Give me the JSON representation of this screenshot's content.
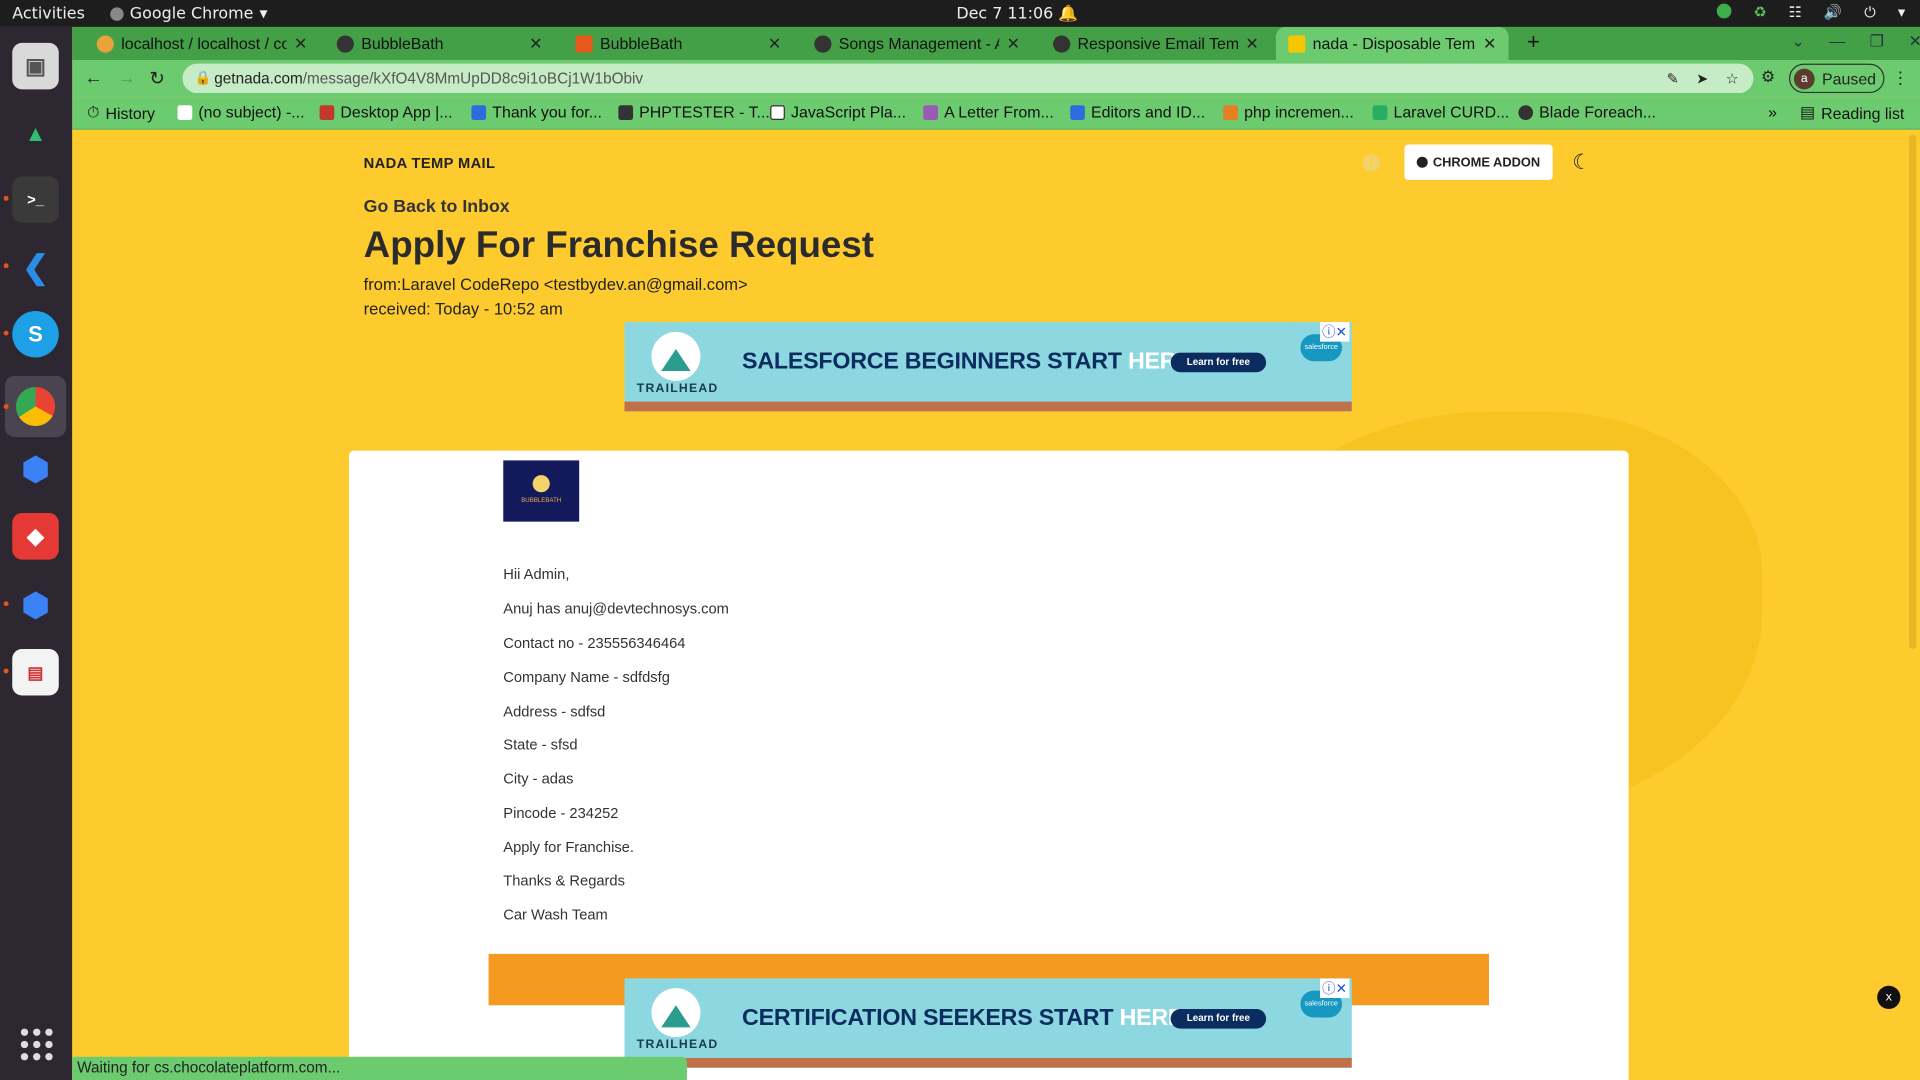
{
  "topbar": {
    "activities": "Activities",
    "app_name": "Google Chrome",
    "clock": "Dec 7  11:06"
  },
  "tabs": [
    {
      "title": "localhost / localhost / cor",
      "favicon_color": "#e8a33c"
    },
    {
      "title": "BubbleBath",
      "favicon_color": "#333"
    },
    {
      "title": "BubbleBath",
      "favicon_color": "#e65a1d"
    },
    {
      "title": "Songs Management - Adm",
      "favicon_color": "#333"
    },
    {
      "title": "Responsive Email Templat",
      "favicon_color": "#333"
    },
    {
      "title": "nada - Disposable Temp E",
      "favicon_color": "#f7c600"
    }
  ],
  "toolbar": {
    "url_host": "getnada.com",
    "url_path": "/message/kXfO4V8MmUpDD8c9i1oBCj1W1bObiv",
    "profile_initial": "a",
    "profile_status": "Paused"
  },
  "bookmarks": [
    {
      "label": "History"
    },
    {
      "label": "(no subject) -..."
    },
    {
      "label": "Desktop App |..."
    },
    {
      "label": "Thank you for..."
    },
    {
      "label": "PHPTESTER - T..."
    },
    {
      "label": "JavaScript Pla..."
    },
    {
      "label": "A Letter From..."
    },
    {
      "label": "Editors and ID..."
    },
    {
      "label": "php incremen..."
    },
    {
      "label": "Laravel CURD..."
    },
    {
      "label": "Blade Foreach..."
    }
  ],
  "reading_list": "Reading list",
  "page": {
    "brand": "NADA TEMP MAIL",
    "addon_label": "CHROME ADDON",
    "back_link": "Go Back to Inbox",
    "subject": "Apply For Franchise Request",
    "from": "from:Laravel CodeRepo <testbydev.an@gmail.com>",
    "received": "received: Today - 10:52 am"
  },
  "ads": [
    {
      "brand": "TRAILHEAD",
      "headline": "SALESFORCE BEGINNERS START ",
      "headline_accent": "HERE.",
      "cta": "Learn for free",
      "badge": "salesforce"
    },
    {
      "brand": "TRAILHEAD",
      "headline": "CERTIFICATION SEEKERS START ",
      "headline_accent": "HERE.",
      "cta": "Learn for free",
      "badge": "salesforce"
    }
  ],
  "email": {
    "logo_text": "BUBBLEBATH",
    "lines": [
      "Hii Admin,",
      "Anuj has anuj@devtechnosys.com",
      "Contact no - 235556346464",
      "Company Name - sdfdsfg",
      "Address - sdfsd",
      "State - sfsd",
      "City - adas",
      "Pincode - 234252",
      "Apply for Franchise.",
      "Thanks & Regards",
      "Car Wash Team"
    ]
  },
  "close_x": "x",
  "status_text": "Waiting for cs.chocolateplatform.com..."
}
